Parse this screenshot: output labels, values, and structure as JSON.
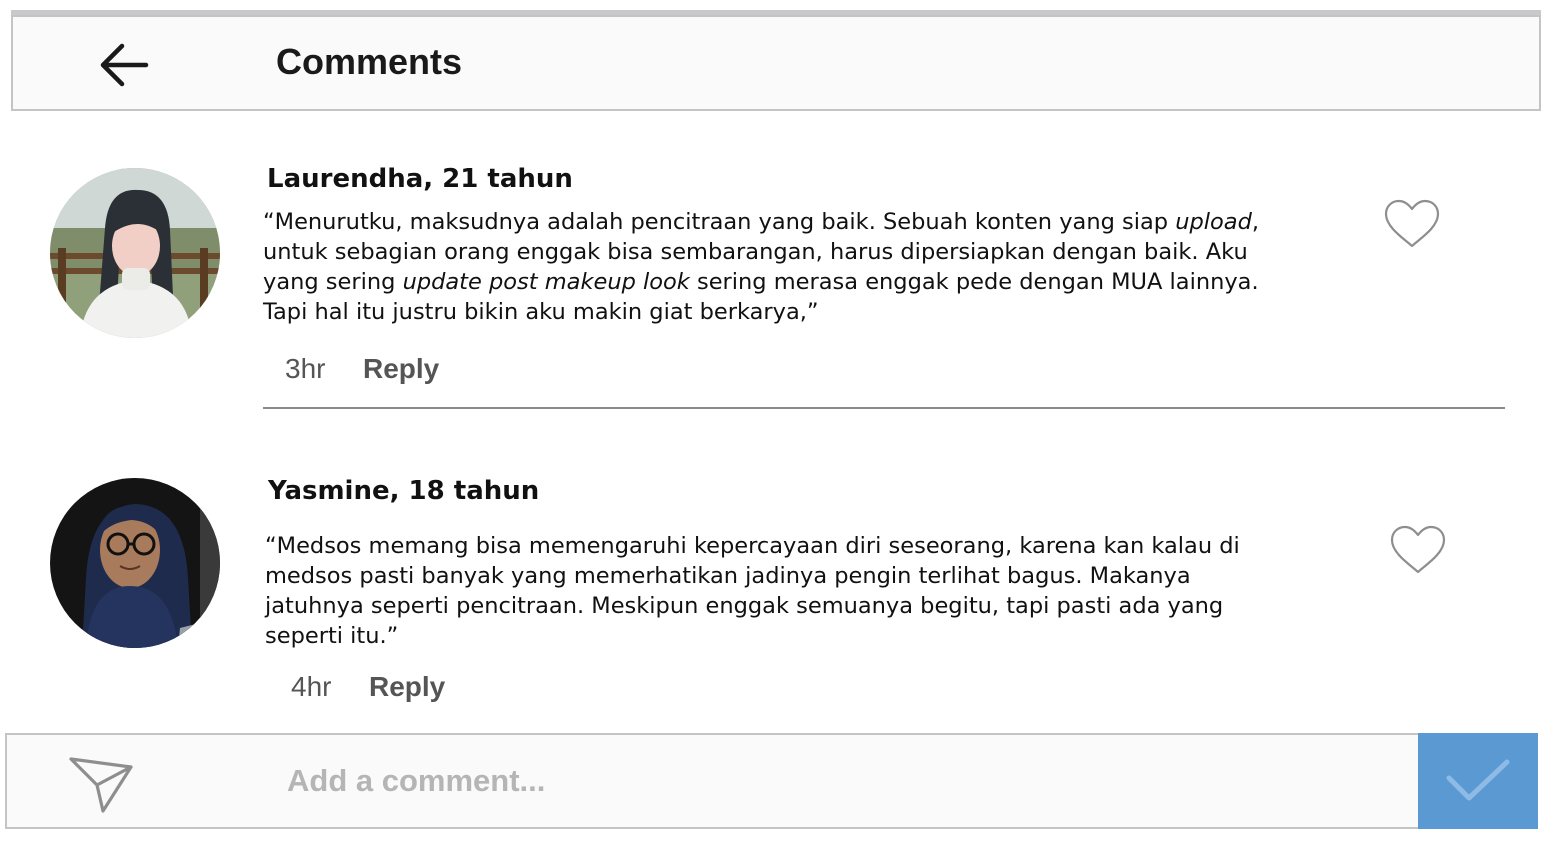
{
  "header": {
    "title": "Comments",
    "back_icon": "arrow-left-icon"
  },
  "comments": [
    {
      "author": "Laurendha, 21 tahun",
      "text_lines": [
        [
          {
            "t": "“Menurutku, maksudnya adalah pencitraan yang baik. Sebuah konten yang siap "
          },
          {
            "t": "upload",
            "i": true
          },
          {
            "t": ","
          }
        ],
        [
          {
            "t": "untuk sebagian orang enggak bisa sembarangan, harus dipersiapkan dengan baik. Aku"
          }
        ],
        [
          {
            "t": "yang sering "
          },
          {
            "t": "update post makeup look",
            "i": true
          },
          {
            "t": " sering merasa enggak pede dengan MUA lainnya."
          }
        ],
        [
          {
            "t": "Tapi hal itu justru bikin aku makin giat berkarya,”"
          }
        ]
      ],
      "time": "3hr",
      "reply_label": "Reply",
      "like_icon": "heart-outline-icon"
    },
    {
      "author": "Yasmine, 18 tahun",
      "text_lines": [
        [
          {
            "t": "“Medsos memang bisa memengaruhi kepercayaan diri seseorang, karena kan kalau di"
          }
        ],
        [
          {
            "t": "medsos pasti banyak yang memerhatikan jadinya pengin terlihat bagus. Makanya"
          }
        ],
        [
          {
            "t": "jatuhnya seperti pencitraan. Meskipun enggak semuanya begitu, tapi pasti ada yang"
          }
        ],
        [
          {
            "t": "seperti itu.”"
          }
        ]
      ],
      "time": "4hr",
      "reply_label": "Reply",
      "like_icon": "heart-outline-icon"
    }
  ],
  "composer": {
    "placeholder": "Add a comment...",
    "value": "",
    "send_icon": "paper-plane-icon",
    "submit_icon": "checkmark-icon"
  },
  "colors": {
    "submit_bg": "#5b99d3",
    "header_bg": "#fafafa",
    "border": "#c4c4c4",
    "icon_gray": "#8e8e8e"
  }
}
